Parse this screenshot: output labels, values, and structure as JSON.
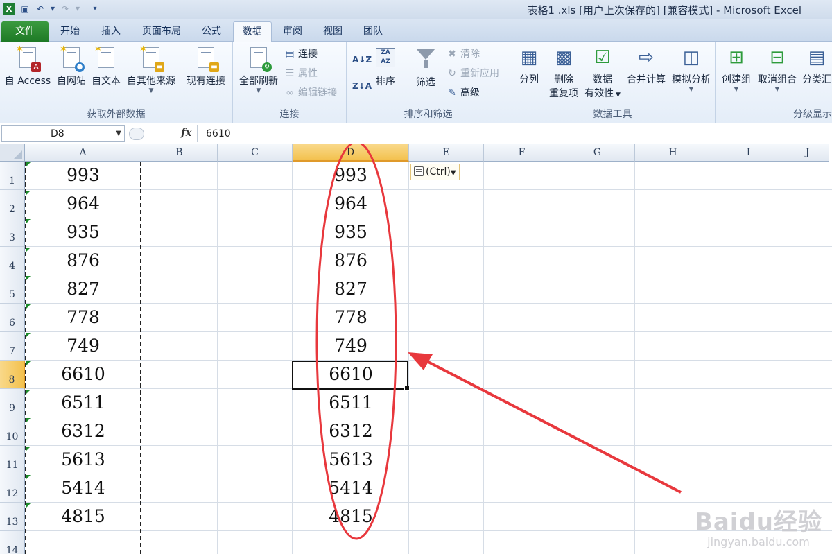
{
  "window": {
    "title": "表格1 .xls [用户上次保存的] [兼容模式] - Microsoft Excel"
  },
  "tabs": [
    {
      "label": "文件",
      "state": "file"
    },
    {
      "label": "开始"
    },
    {
      "label": "插入"
    },
    {
      "label": "页面布局"
    },
    {
      "label": "公式"
    },
    {
      "label": "数据",
      "state": "active"
    },
    {
      "label": "审阅"
    },
    {
      "label": "视图"
    },
    {
      "label": "团队"
    }
  ],
  "ribbon": {
    "external": {
      "label": "获取外部数据",
      "access": "自 Access",
      "web": "自网站",
      "text": "自文本",
      "other": "自其他来源",
      "existing": "现有连接"
    },
    "connections": {
      "label": "连接",
      "refresh_all": "全部刷新",
      "connections": "连接",
      "properties": "属性",
      "edit_links": "编辑链接"
    },
    "sort_filter": {
      "label": "排序和筛选",
      "sort": "排序",
      "filter": "筛选",
      "clear": "清除",
      "reapply": "重新应用",
      "advanced": "高级"
    },
    "data_tools": {
      "label": "数据工具",
      "text_to_columns": "分列",
      "remove_dup_1": "删除",
      "remove_dup_2": "重复项",
      "validation_1": "数据",
      "validation_2": "有效性",
      "consolidate": "合并计算",
      "what_if": "模拟分析"
    },
    "outline": {
      "label": "分级显示",
      "group": "创建组",
      "ungroup": "取消组合",
      "subtotal": "分类汇"
    }
  },
  "formula_bar": {
    "name_box": "D8",
    "fx": "fx",
    "value": "6610"
  },
  "sheet": {
    "columns": [
      "A",
      "B",
      "C",
      "D",
      "E",
      "F",
      "G",
      "H",
      "I",
      "J"
    ],
    "selected_column": "D",
    "rows": [
      "1",
      "2",
      "3",
      "4",
      "5",
      "6",
      "7",
      "8",
      "9",
      "10",
      "11",
      "12",
      "13",
      "14"
    ],
    "selected_row": "8",
    "col_a": [
      "993",
      "964",
      "935",
      "876",
      "827",
      "778",
      "749",
      "6610",
      "6511",
      "6312",
      "5613",
      "5414",
      "4815"
    ],
    "col_d": [
      "993",
      "964",
      "935",
      "876",
      "827",
      "778",
      "749",
      "6610",
      "6511",
      "6312",
      "5613",
      "5414",
      "4815"
    ],
    "paste_options": "(Ctrl)"
  },
  "annotation": {
    "color": "#e8383d"
  },
  "watermark": {
    "main": "Baidu经验",
    "sub": "jingyan.baidu.com"
  }
}
